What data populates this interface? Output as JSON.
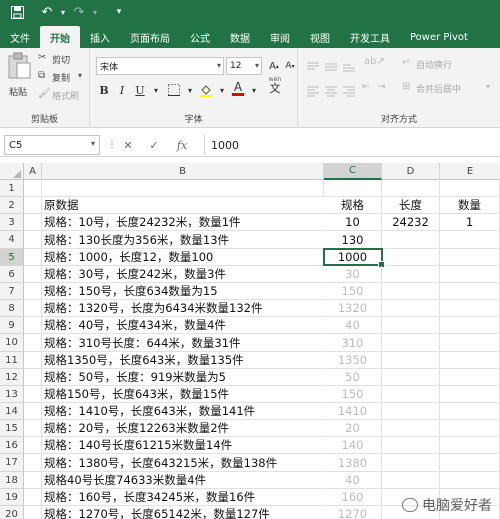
{
  "quick_access": {
    "save_icon": "save-icon",
    "undo_icon": "undo-icon",
    "redo_icon": "redo-icon",
    "customize_icon": "customize-quick-access-icon"
  },
  "tabs": [
    "文件",
    "开始",
    "插入",
    "页面布局",
    "公式",
    "数据",
    "审阅",
    "视图",
    "开发工具",
    "Power Pivot"
  ],
  "active_tab": "开始",
  "ribbon": {
    "clipboard": {
      "paste": "粘贴",
      "cut": "剪切",
      "copy": "复制",
      "format_painter": "格式刷",
      "label": "剪贴板"
    },
    "font": {
      "font_name": "宋体",
      "font_size": "12",
      "bold": "B",
      "italic": "I",
      "underline": "U",
      "font_color_letter": "A",
      "pinyin": "wén",
      "label": "字体"
    },
    "alignment": {
      "wrap_text": "自动换行",
      "merge_center": "合并后居中",
      "label": "对齐方式"
    }
  },
  "formula_bar": {
    "name_box": "C5",
    "cancel": "✕",
    "enter": "✓",
    "fx": "fx",
    "value": "1000"
  },
  "columns": [
    "A",
    "B",
    "C",
    "D",
    "E"
  ],
  "active_column": "C",
  "active_row": "5",
  "rows": [
    {
      "num": "1",
      "b": "",
      "c": "",
      "d": "",
      "e": ""
    },
    {
      "num": "2",
      "b": "原数据",
      "c": "规格",
      "d": "长度",
      "e": "数量"
    },
    {
      "num": "3",
      "b": "规格：10号，长度24232米，数量1件",
      "c": "10",
      "d": "24232",
      "e": "1"
    },
    {
      "num": "4",
      "b": "规格：130长度为356米，数量13件",
      "c": "130",
      "d": "",
      "e": ""
    },
    {
      "num": "5",
      "b": "规格：1000，长度12，数量100",
      "c": "1000",
      "d": "",
      "e": ""
    },
    {
      "num": "6",
      "b": "规格：30号，长度242米，数量3件",
      "c": "30",
      "d": "",
      "e": ""
    },
    {
      "num": "7",
      "b": "规格：150号，长度634数量为15",
      "c": "150",
      "d": "",
      "e": ""
    },
    {
      "num": "8",
      "b": "规格：1320号，长度为6434米数量132件",
      "c": "1320",
      "d": "",
      "e": ""
    },
    {
      "num": "9",
      "b": "规格：40号，长度434米，数量4件",
      "c": "40",
      "d": "",
      "e": ""
    },
    {
      "num": "10",
      "b": "规格：310号长度：644米，数量31件",
      "c": "310",
      "d": "",
      "e": ""
    },
    {
      "num": "11",
      "b": "规格1350号，长度643米，数量135件",
      "c": "1350",
      "d": "",
      "e": ""
    },
    {
      "num": "12",
      "b": "规格：50号，长度：919米数量为5",
      "c": "50",
      "d": "",
      "e": ""
    },
    {
      "num": "13",
      "b": "规格150号，长度643米，数量15件",
      "c": "150",
      "d": "",
      "e": ""
    },
    {
      "num": "14",
      "b": "规格：1410号，长度643米，数量141件",
      "c": "1410",
      "d": "",
      "e": ""
    },
    {
      "num": "15",
      "b": "规格：20号，长度12263米数量2件",
      "c": "20",
      "d": "",
      "e": ""
    },
    {
      "num": "16",
      "b": "规格：140号长度61215米数量14件",
      "c": "140",
      "d": "",
      "e": ""
    },
    {
      "num": "17",
      "b": "规格：1380号，长度643215米，数量138件",
      "c": "1380",
      "d": "",
      "e": ""
    },
    {
      "num": "18",
      "b": "规格40号长度74633米数量4件",
      "c": "40",
      "d": "",
      "e": ""
    },
    {
      "num": "19",
      "b": "规格：160号，长度34245米，数量16件",
      "c": "160",
      "d": "",
      "e": ""
    },
    {
      "num": "20",
      "b": "规格：1270号，长度65142米，数量127件",
      "c": "1270",
      "d": "",
      "e": ""
    }
  ],
  "watermark": "电脑爱好者",
  "colors": {
    "excel_green": "#217346",
    "ribbon_bg": "#f3f3f3",
    "flash_fill_preview": "#bdbdbd"
  }
}
